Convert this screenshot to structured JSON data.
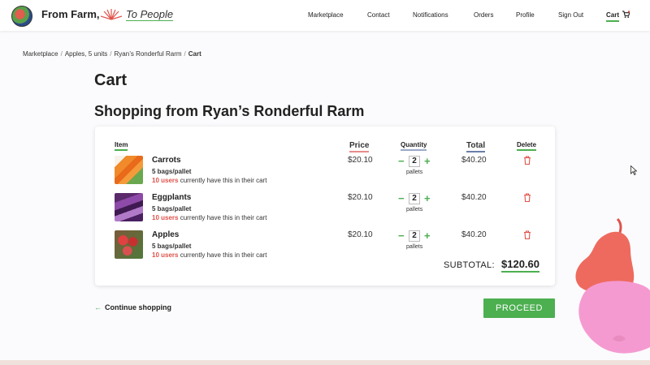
{
  "header": {
    "brand": "From Farm,",
    "tagline": "To People",
    "nav": [
      "Marketplace",
      "Contact",
      "Notifications",
      "Orders",
      "Profile",
      "Sign Out",
      "Cart"
    ]
  },
  "breadcrumb": [
    "Marketplace",
    "Apples, 5 units",
    "Ryan’s Ronderful Rarm",
    "Cart"
  ],
  "page": {
    "title": "Cart",
    "shop_title": "Shopping from Ryan’s Ronderful Rarm"
  },
  "table": {
    "headers": {
      "item": "Item",
      "price": "Price",
      "quantity": "Quantity",
      "total": "Total",
      "delete": "Delete"
    },
    "rows": [
      {
        "name": "Carrots",
        "unit_desc": "5 bags/pallet",
        "users_count": "10 users",
        "users_text": "currently have this in their cart",
        "price": "$20.10",
        "qty": "2",
        "qty_unit": "pallets",
        "total": "$40.20",
        "thumb": "carrots"
      },
      {
        "name": "Eggplants",
        "unit_desc": "5 bags/pallet",
        "users_count": "10 users",
        "users_text": "currently have this in their cart",
        "price": "$20.10",
        "qty": "2",
        "qty_unit": "pallets",
        "total": "$40.20",
        "thumb": "eggplants"
      },
      {
        "name": "Apples",
        "unit_desc": "5 bags/pallet",
        "users_count": "10 users",
        "users_text": "currently have this in their cart",
        "price": "$20.10",
        "qty": "2",
        "qty_unit": "pallets",
        "total": "$40.20",
        "thumb": "apples"
      }
    ],
    "minus": "−",
    "plus": "+"
  },
  "summary": {
    "subtotal_label": "SUBTOTAL:",
    "subtotal_value": "$120.60"
  },
  "actions": {
    "continue_label": "Continue shopping",
    "continue_arrow": "←",
    "proceed_label": "PROCEED"
  },
  "colors": {
    "accent": "#4caf50",
    "highlight": "#e0524a"
  }
}
